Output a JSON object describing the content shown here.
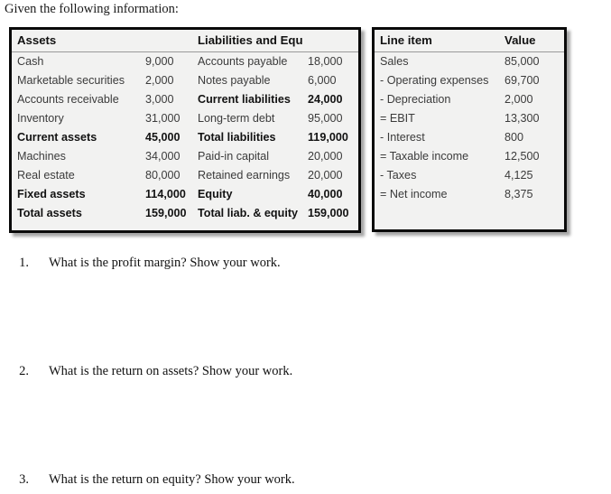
{
  "intro": {
    "text": "Given the following information:"
  },
  "balance_sheet": {
    "headers": {
      "assets": "Assets",
      "assets_value": "",
      "liabilities": "Liabilities and Equity",
      "liabilities_value": ""
    },
    "rows": [
      {
        "asset_label": "Cash",
        "asset_value": "9,000",
        "liab_label": "Accounts payable",
        "liab_value": "18,000",
        "bold": false
      },
      {
        "asset_label": "Marketable securities",
        "asset_value": "2,000",
        "liab_label": "Notes payable",
        "liab_value": "6,000",
        "bold": false
      },
      {
        "asset_label": "Accounts receivable",
        "asset_value": "3,000",
        "liab_label": "Current liabilities",
        "liab_value": "24,000",
        "bold": "liab"
      },
      {
        "asset_label": "Inventory",
        "asset_value": "31,000",
        "liab_label": "Long-term debt",
        "liab_value": "95,000",
        "bold": false
      },
      {
        "asset_label": "Current assets",
        "asset_value": "45,000",
        "liab_label": "Total liabilities",
        "liab_value": "119,000",
        "bold": "both"
      },
      {
        "asset_label": "Machines",
        "asset_value": "34,000",
        "liab_label": "Paid-in capital",
        "liab_value": "20,000",
        "bold": false
      },
      {
        "asset_label": "Real estate",
        "asset_value": "80,000",
        "liab_label": "Retained earnings",
        "liab_value": "20,000",
        "bold": false
      },
      {
        "asset_label": "Fixed assets",
        "asset_value": "114,000",
        "liab_label": "Equity",
        "liab_value": "40,000",
        "bold": "both"
      },
      {
        "asset_label": "Total assets",
        "asset_value": "159,000",
        "liab_label": "Total liab. & equity",
        "liab_value": "159,000",
        "bold": "both"
      }
    ]
  },
  "income_statement": {
    "headers": {
      "line_item": "Line item",
      "value": "Value"
    },
    "rows": [
      {
        "label": "Sales",
        "value": "85,000"
      },
      {
        "label": "- Operating expenses",
        "value": "69,700"
      },
      {
        "label": "- Depreciation",
        "value": "2,000"
      },
      {
        "label": "= EBIT",
        "value": "13,300"
      },
      {
        "label": "- Interest",
        "value": "800"
      },
      {
        "label": "= Taxable income",
        "value": "12,500"
      },
      {
        "label": "- Taxes",
        "value": "4,125"
      },
      {
        "label": "= Net income",
        "value": "8,375"
      }
    ]
  },
  "questions": [
    {
      "number": "1.",
      "text": "What is the profit margin?  Show your work."
    },
    {
      "number": "2.",
      "text": "What is the return on assets?  Show your work."
    },
    {
      "number": "3.",
      "text": "What is the return on equity?  Show your work."
    }
  ]
}
